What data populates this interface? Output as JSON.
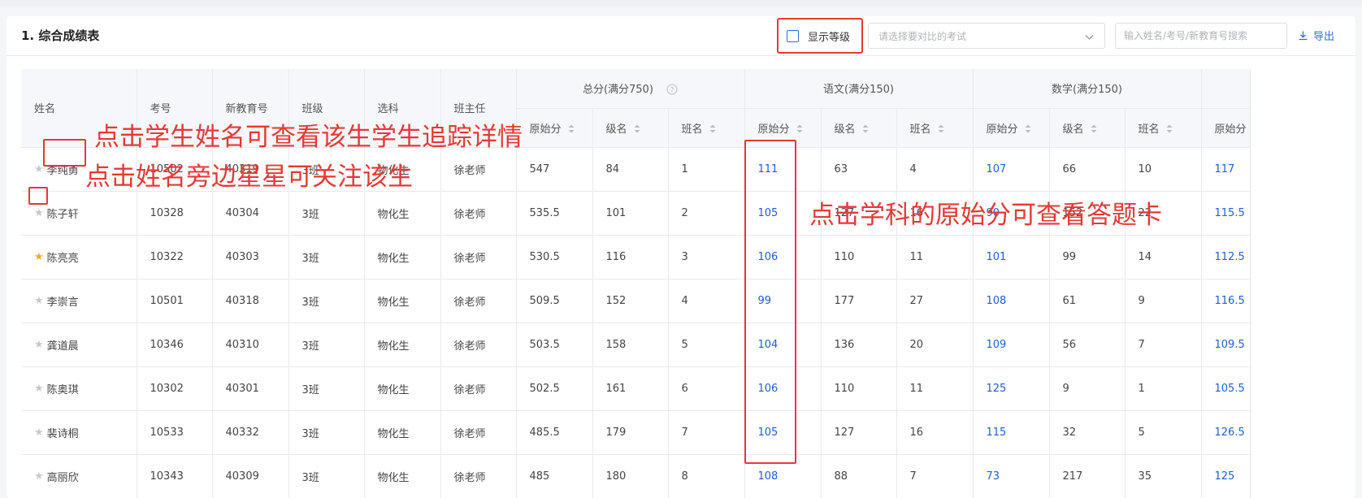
{
  "header": {
    "title": "1. 综合成绩表",
    "show_grade_label": "显示等级",
    "compare_placeholder": "请选择要对比的考试",
    "search_placeholder": "输入姓名/考号/新教育号搜索",
    "export_label": "导出"
  },
  "columns": {
    "name": "姓名",
    "exam_no": "考号",
    "edu_no": "新教育号",
    "class": "班级",
    "subjects": "选科",
    "teacher": "班主任"
  },
  "groups": [
    {
      "title": "总分(满分750)",
      "has_help": true
    },
    {
      "title": "语文(满分150)",
      "has_help": false
    },
    {
      "title": "数学(满分150)",
      "has_help": false
    }
  ],
  "subcols": {
    "raw": "原始分",
    "grade_rank": "级名",
    "class_rank": "班名"
  },
  "next_group_raw": "原始分",
  "rows": [
    {
      "starred": false,
      "name": "李纯勇",
      "exam_no": "10502",
      "edu_no": "40319",
      "class": "3班",
      "subjects": "物化生",
      "teacher": "徐老师",
      "total": [
        "547",
        "84",
        "1"
      ],
      "chinese": [
        "111",
        "63",
        "4"
      ],
      "math": [
        "107",
        "66",
        "10"
      ],
      "next": "117"
    },
    {
      "starred": false,
      "name": "陈子轩",
      "exam_no": "10328",
      "edu_no": "40304",
      "class": "3班",
      "subjects": "物化生",
      "teacher": "徐老师",
      "total": [
        "535.5",
        "101",
        "2"
      ],
      "chinese": [
        "105",
        "127",
        "16"
      ],
      "math": [
        "90",
        "152",
        "22"
      ],
      "next": "115.5"
    },
    {
      "starred": true,
      "name": "陈亮亮",
      "exam_no": "10322",
      "edu_no": "40303",
      "class": "3班",
      "subjects": "物化生",
      "teacher": "徐老师",
      "total": [
        "530.5",
        "116",
        "3"
      ],
      "chinese": [
        "106",
        "110",
        "11"
      ],
      "math": [
        "101",
        "99",
        "14"
      ],
      "next": "112.5"
    },
    {
      "starred": false,
      "name": "李崇言",
      "exam_no": "10501",
      "edu_no": "40318",
      "class": "3班",
      "subjects": "物化生",
      "teacher": "徐老师",
      "total": [
        "509.5",
        "152",
        "4"
      ],
      "chinese": [
        "99",
        "177",
        "27"
      ],
      "math": [
        "108",
        "61",
        "9"
      ],
      "next": "116.5"
    },
    {
      "starred": false,
      "name": "龚道晨",
      "exam_no": "10346",
      "edu_no": "40310",
      "class": "3班",
      "subjects": "物化生",
      "teacher": "徐老师",
      "total": [
        "503.5",
        "158",
        "5"
      ],
      "chinese": [
        "104",
        "136",
        "20"
      ],
      "math": [
        "109",
        "56",
        "7"
      ],
      "next": "109.5"
    },
    {
      "starred": false,
      "name": "陈奥琪",
      "exam_no": "10302",
      "edu_no": "40301",
      "class": "3班",
      "subjects": "物化生",
      "teacher": "徐老师",
      "total": [
        "502.5",
        "161",
        "6"
      ],
      "chinese": [
        "106",
        "110",
        "11"
      ],
      "math": [
        "125",
        "9",
        "1"
      ],
      "next": "105.5"
    },
    {
      "starred": false,
      "name": "裴诗桐",
      "exam_no": "10533",
      "edu_no": "40332",
      "class": "3班",
      "subjects": "物化生",
      "teacher": "徐老师",
      "total": [
        "485.5",
        "179",
        "7"
      ],
      "chinese": [
        "105",
        "127",
        "16"
      ],
      "math": [
        "115",
        "32",
        "5"
      ],
      "next": "126.5"
    },
    {
      "starred": false,
      "name": "高丽欣",
      "exam_no": "10343",
      "edu_no": "40309",
      "class": "3班",
      "subjects": "物化生",
      "teacher": "徐老师",
      "total": [
        "485",
        "180",
        "8"
      ],
      "chinese": [
        "108",
        "88",
        "7"
      ],
      "math": [
        "73",
        "217",
        "35"
      ],
      "next": "125"
    }
  ],
  "annotations": {
    "name_tip": "点击学生姓名可查看该生学生追踪详情",
    "star_tip": "点击姓名旁边星星可关注该生",
    "raw_tip": "点击学科的原始分可查看答题卡"
  },
  "colors": {
    "accent": "#2b6fd6",
    "link": "#1e5fd0",
    "annotation": "#e53935",
    "star_on": "#f5a623",
    "star_off": "#c5c8ce"
  }
}
